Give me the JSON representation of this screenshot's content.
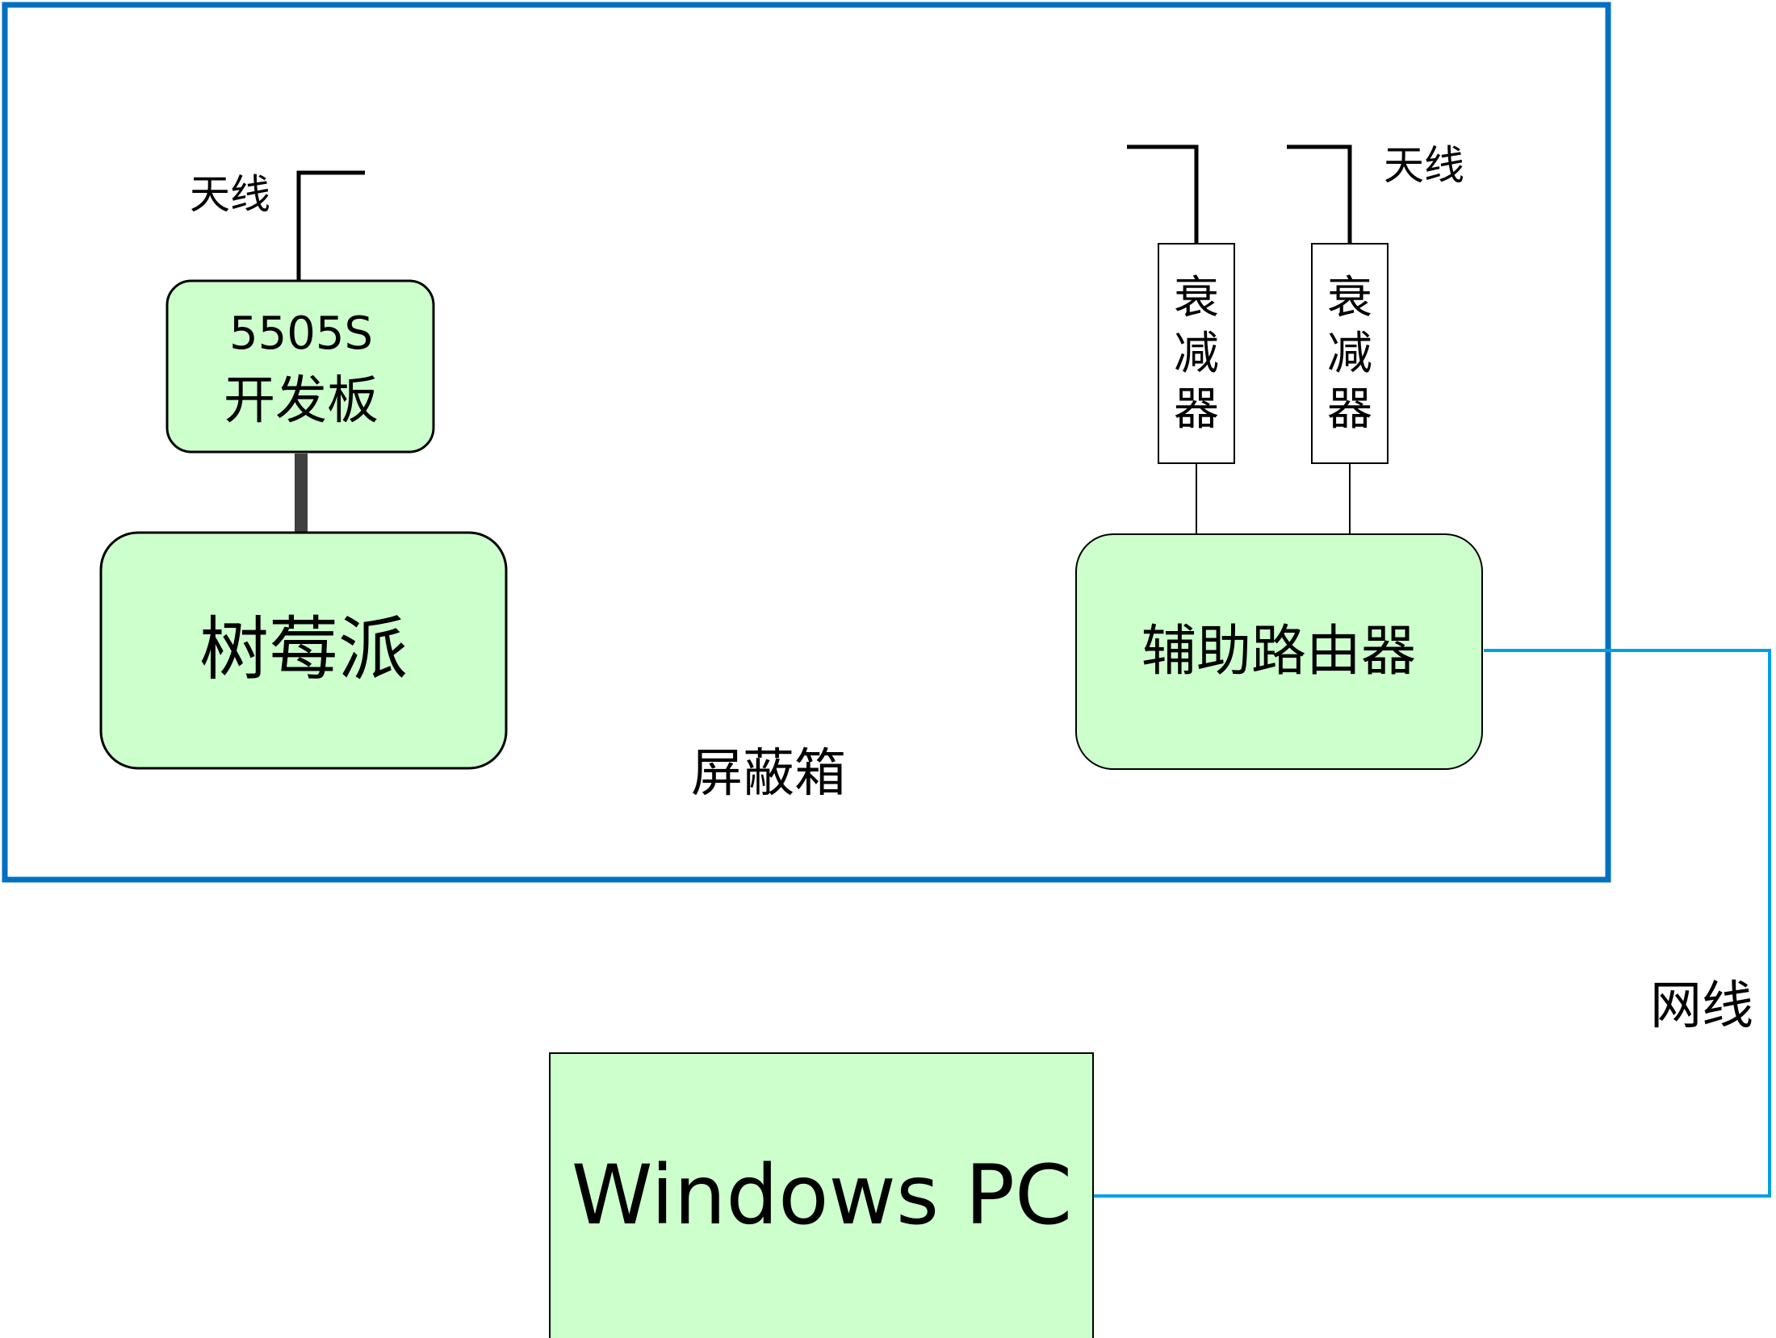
{
  "labels": {
    "shield_box": "屏蔽箱",
    "antenna_left": "天线",
    "antenna_right": "天线",
    "network_cable": "网线"
  },
  "nodes": {
    "dev_board": {
      "line1": "5505S",
      "line2": "开发板"
    },
    "raspberry_pi": "树莓派",
    "router": "辅助路由器",
    "attenuator_1": [
      "衰",
      "减",
      "器"
    ],
    "attenuator_2": [
      "衰",
      "减",
      "器"
    ],
    "windows_pc": "Windows PC"
  },
  "colors": {
    "node_fill": "#ccffcc",
    "shield_border": "#0070c0",
    "network_line": "#00a0e6",
    "stroke": "#000000",
    "connector": "#404040"
  }
}
